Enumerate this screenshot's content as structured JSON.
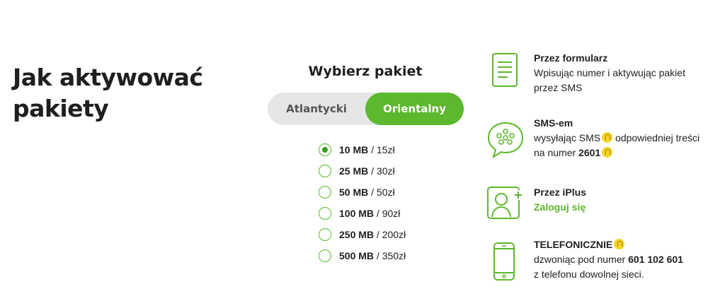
{
  "page": {
    "title_line1": "Jak aktywować",
    "title_line2": "pakiety"
  },
  "picker": {
    "title": "Wybierz pakiet",
    "options": [
      {
        "label": "Atlantycki",
        "active": false
      },
      {
        "label": "Orientalny",
        "active": true
      }
    ],
    "packages": [
      {
        "size": "10 MB",
        "price": " / 15zł",
        "selected": true
      },
      {
        "size": "25 MB",
        "price": " / 30zł",
        "selected": false
      },
      {
        "size": "50 MB",
        "price": " / 50zł",
        "selected": false
      },
      {
        "size": "100 MB",
        "price": " / 90zł",
        "selected": false
      },
      {
        "size": "250 MB",
        "price": " / 200zł",
        "selected": false
      },
      {
        "size": "500 MB",
        "price": " / 350zł",
        "selected": false
      }
    ]
  },
  "methods": {
    "form": {
      "icon": "document-icon",
      "heading": "Przez formularz",
      "line1": "Wpisując numer i aktywując pakiet",
      "line2": "przez SMS"
    },
    "sms": {
      "icon": "chat-bubble-icon",
      "heading": "SMS-em",
      "line1_a": "wysyłając SMS",
      "line1_b": " odpowiedniej treści",
      "line2_a": "na numer ",
      "number": "2601"
    },
    "iplus": {
      "icon": "user-profile-icon",
      "heading": "Przez iPlus",
      "link": "Zaloguj się"
    },
    "phone": {
      "icon": "smartphone-icon",
      "heading": "TELEFONICZNIE",
      "line1_a": "dzwoniąc pod numer ",
      "number": "601 102 601",
      "line2": "z telefonu dowolnej sieci."
    }
  },
  "colors": {
    "accent": "#5cb82c",
    "toggle_bg": "#e6e6e6",
    "hint_bulb": "#f6d524"
  }
}
